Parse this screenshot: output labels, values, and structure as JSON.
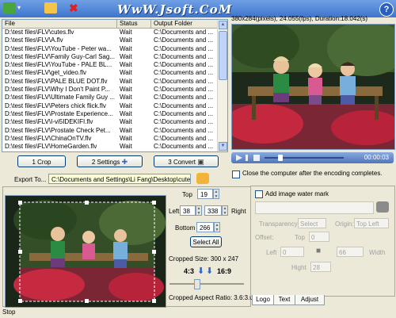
{
  "toolbar": {
    "watermark_text": "WwW.Jsoft.CoM",
    "icons": [
      "add-file-icon",
      "dropdown-arrow-icon",
      "open-folder-icon",
      "delete-icon",
      "help-icon"
    ],
    "help_glyph": "?"
  },
  "file_table": {
    "columns": [
      "File",
      "Status",
      "Output Folder"
    ],
    "rows": [
      {
        "file": "D:\\test files\\FLV\\cutes.flv",
        "status": "Wait",
        "folder": "C:\\Documents and ..."
      },
      {
        "file": "D:\\test files\\FLV\\A.flv",
        "status": "Wait",
        "folder": "C:\\Documents and ..."
      },
      {
        "file": "D:\\test files\\FLV\\YouTube - Peter wa...",
        "status": "Wait",
        "folder": "C:\\Documents and ..."
      },
      {
        "file": "D:\\test files\\FLV\\Family Guy-Carl Sag...",
        "status": "Wait",
        "folder": "C:\\Documents and ..."
      },
      {
        "file": "D:\\test files\\FLV\\YouTube - PALE BL...",
        "status": "Wait",
        "folder": "C:\\Documents and ..."
      },
      {
        "file": "D:\\test files\\FLV\\get_video.flv",
        "status": "Wait",
        "folder": "C:\\Documents and ..."
      },
      {
        "file": "D:\\test files\\FLV\\PALE BLUE DOT.flv",
        "status": "Wait",
        "folder": "C:\\Documents and ..."
      },
      {
        "file": "D:\\test files\\FLV\\Why I Don't Paint P...",
        "status": "Wait",
        "folder": "C:\\Documents and ..."
      },
      {
        "file": "D:\\test files\\FLV\\Ultimate Family Guy ...",
        "status": "Wait",
        "folder": "C:\\Documents and ..."
      },
      {
        "file": "D:\\test files\\FLV\\Peters chick flick.flv",
        "status": "Wait",
        "folder": "C:\\Documents and ..."
      },
      {
        "file": "D:\\test files\\FLV\\Prostate Experience...",
        "status": "Wait",
        "folder": "C:\\Documents and ..."
      },
      {
        "file": "D:\\test files\\FLV\\I-vi5IDEKIFI.flv",
        "status": "Wait",
        "folder": "C:\\Documents and ..."
      },
      {
        "file": "D:\\test files\\FLV\\Prostate Check Pet...",
        "status": "Wait",
        "folder": "C:\\Documents and ..."
      },
      {
        "file": "D:\\test files\\FLV\\ChinaOnTV.flv",
        "status": "Wait",
        "folder": "C:\\Documents and ..."
      },
      {
        "file": "D:\\test files\\FLV\\HomeGarden.flv",
        "status": "Wait",
        "folder": "C:\\Documents and ..."
      }
    ]
  },
  "preview": {
    "info": "380x284(pixels), 24.055(fps), Duration:18.042(s)",
    "time": "00:00:03"
  },
  "steps": {
    "crop": "1 Crop",
    "settings": "2 Settings",
    "convert": "3 Convert"
  },
  "shutdown_label": "Close the computer after the encoding completes.",
  "export": {
    "label": "Export To...",
    "path": "C:\\Documents and Settings\\Li Fang\\Desktop\\cute"
  },
  "crop": {
    "top_label": "Top",
    "top": "19",
    "left_label": "Left",
    "left": "38",
    "right_label": "Right",
    "right": "338",
    "bottom_label": "Bottom",
    "bottom": "266",
    "select_all": "Select All",
    "cropped_size": "Cropped Size: 300 x 247",
    "ratio_left": "4:3",
    "ratio_right": "16:9",
    "aspect_ratio": "Cropped Aspect Ratio: 3.6:3.0"
  },
  "watermark": {
    "checkbox_label": "Add image water mark",
    "transparency_label": "Transparency:",
    "transparency_value": "Select",
    "origin_label": "Origin:",
    "origin_value": "Top Left",
    "offset_label": "Offset:",
    "top_label": "Top",
    "top_value": "0",
    "left_label": "Left",
    "left_value": "0",
    "width_label": "Width",
    "width_value": "66",
    "hight_label": "Hight",
    "hight_value": "28",
    "tabs": [
      "Logo",
      "Text",
      "Adjust"
    ]
  },
  "status_bar": "Stop"
}
